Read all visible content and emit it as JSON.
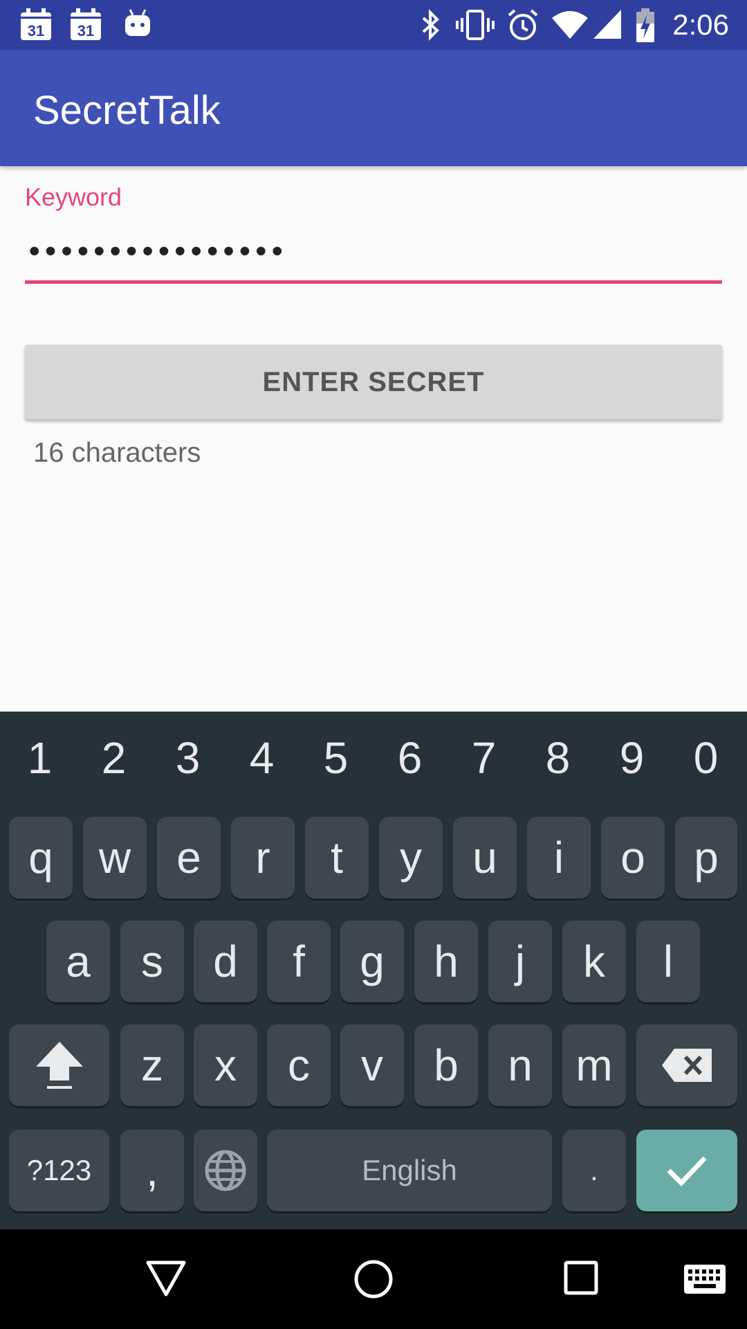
{
  "status_bar": {
    "time": "2:06",
    "left_icons": [
      "calendar-icon",
      "calendar-icon",
      "android-icon"
    ],
    "calendar_day": "31",
    "right_icons": [
      "bluetooth-icon",
      "vibrate-icon",
      "alarm-icon",
      "wifi-icon",
      "signal-icon",
      "battery-charging-icon"
    ]
  },
  "app_bar": {
    "title": "SecretTalk"
  },
  "form": {
    "keyword_label": "Keyword",
    "keyword_value": "••••••••••••••••",
    "enter_button_label": "ENTER SECRET",
    "char_count": "16 characters"
  },
  "keyboard": {
    "number_row": [
      "1",
      "2",
      "3",
      "4",
      "5",
      "6",
      "7",
      "8",
      "9",
      "0"
    ],
    "row1": [
      "q",
      "w",
      "e",
      "r",
      "t",
      "y",
      "u",
      "i",
      "o",
      "p"
    ],
    "row2": [
      "a",
      "s",
      "d",
      "f",
      "g",
      "h",
      "j",
      "k",
      "l"
    ],
    "row3": [
      "z",
      "x",
      "c",
      "v",
      "b",
      "n",
      "m"
    ],
    "symbols_label": "?123",
    "comma_label": ",",
    "space_label": "English",
    "period_label": ".",
    "shift_icon": "shift-icon",
    "backspace_icon": "backspace-icon",
    "globe_icon": "globe-icon",
    "enter_icon": "checkmark-icon"
  },
  "colors": {
    "status_bar": "#303f9f",
    "app_bar": "#3f51b5",
    "accent": "#e8457a",
    "keyboard_bg": "#263238",
    "key_bg": "#3d474d",
    "enter_key": "#69ada6"
  },
  "nav_bar": {
    "icons": [
      "back-icon",
      "home-icon",
      "recents-icon",
      "keyboard-icon"
    ]
  }
}
